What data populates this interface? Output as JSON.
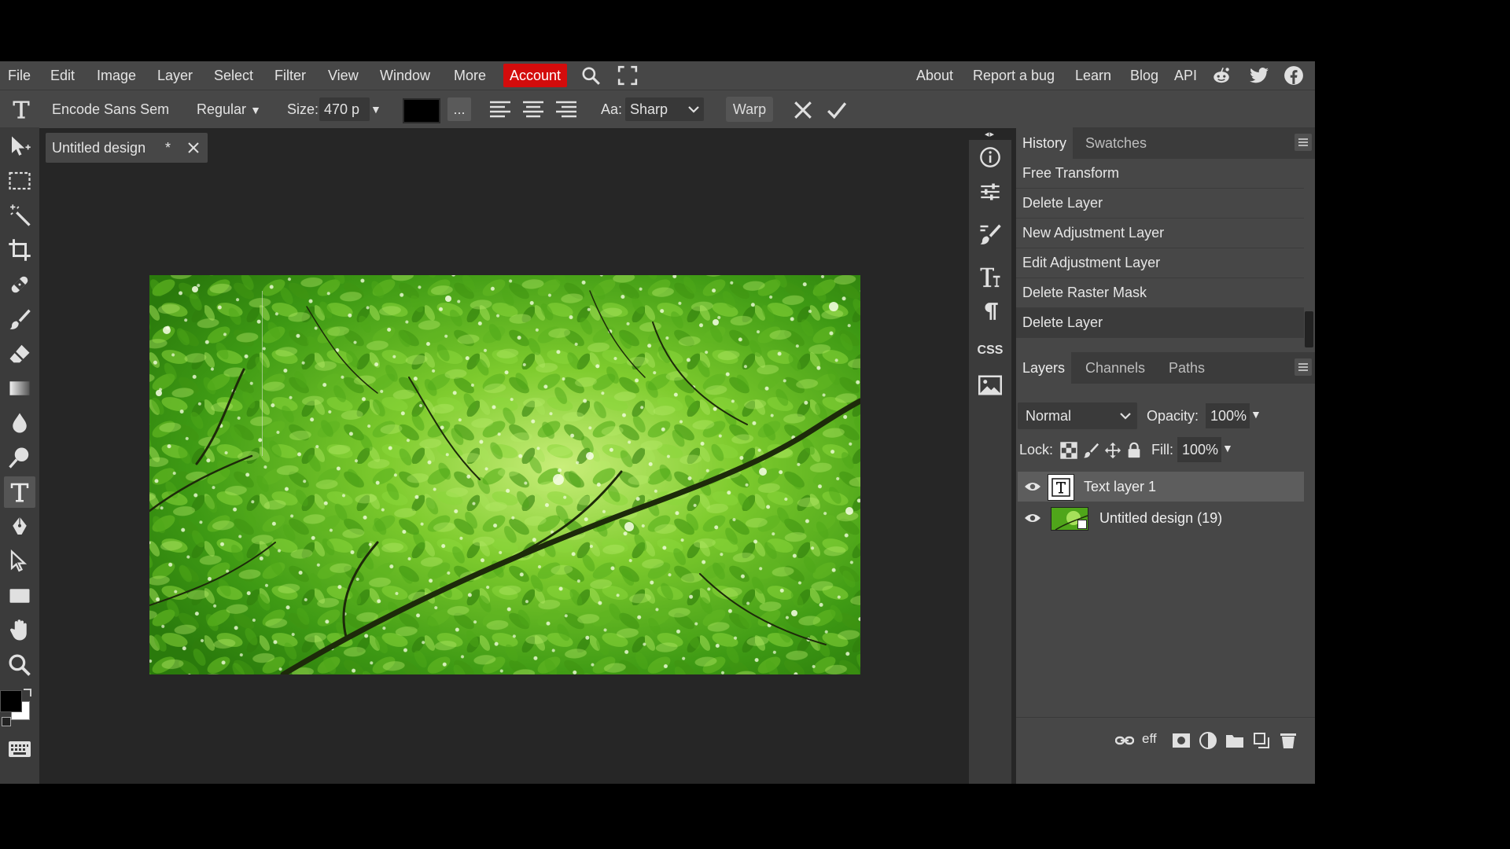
{
  "menu": {
    "items": [
      "File",
      "Edit",
      "Image",
      "Layer",
      "Select",
      "Filter",
      "View",
      "Window",
      "More"
    ],
    "account": "Account",
    "right_links": [
      "About",
      "Report a bug",
      "Learn",
      "Blog",
      "API"
    ],
    "icons": [
      "search-icon",
      "fullscreen-icon",
      "reddit-icon",
      "twitter-icon",
      "facebook-icon"
    ]
  },
  "options": {
    "font_family": "Encode Sans Sem",
    "font_style": "Regular",
    "size_label": "Size:",
    "size_value": "470 p",
    "more": "...",
    "aa_label": "Aa:",
    "aa_value": "Sharp",
    "warp": "Warp",
    "color": "#000000"
  },
  "document": {
    "title": "Untitled design",
    "modified_mark": "*"
  },
  "strip": {
    "css_label": "CSS"
  },
  "history": {
    "tabs": [
      "History",
      "Swatches"
    ],
    "items": [
      "Free Transform",
      "Delete Layer",
      "New Adjustment Layer",
      "Edit Adjustment Layer",
      "Delete Raster Mask",
      "Delete Layer"
    ]
  },
  "layers": {
    "tabs": [
      "Layers",
      "Channels",
      "Paths"
    ],
    "blend_mode": "Normal",
    "opacity_label": "Opacity:",
    "opacity_value": "100%",
    "lock_label": "Lock:",
    "fill_label": "Fill:",
    "fill_value": "100%",
    "items": [
      {
        "name": "Text layer 1",
        "type": "text",
        "selected": true
      },
      {
        "name": "Untitled design (19)",
        "type": "image",
        "selected": false
      }
    ],
    "footer_effects": "eff"
  }
}
